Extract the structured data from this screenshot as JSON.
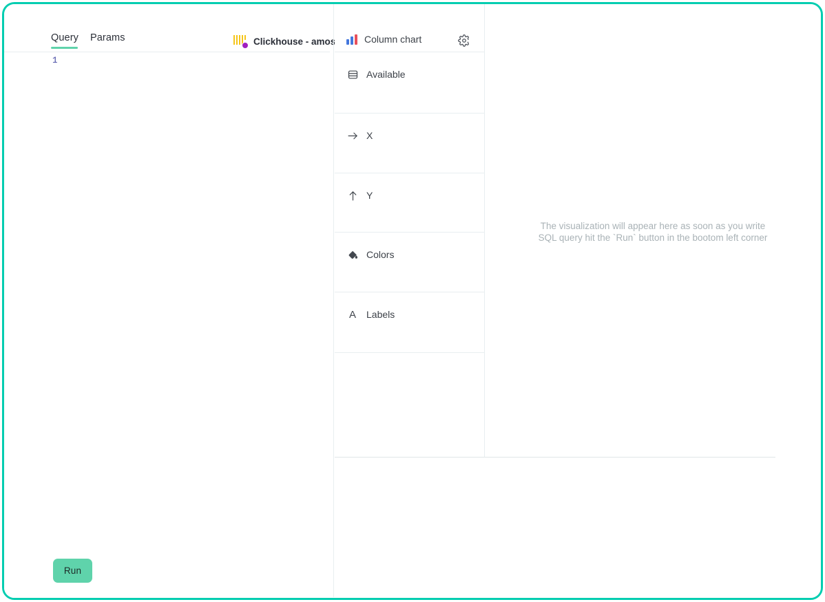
{
  "theme": {
    "frame_border_color": "#00cdb0",
    "accent_green": "#5fd3ab",
    "divider_color": "#e8eef0",
    "placeholder_text_color": "#a9b2b6"
  },
  "query_pane": {
    "tabs": [
      {
        "label": "Query",
        "active": true
      },
      {
        "label": "Params",
        "active": false
      }
    ],
    "connection": {
      "label": "Clickhouse - amos",
      "icon": "clickhouse-icon",
      "bar_color": "#f5c518",
      "badge_color": "#a020c0"
    },
    "editor": {
      "line_numbers": [
        "1"
      ],
      "code": "",
      "placeholder": ""
    },
    "run_button": {
      "label": "Run"
    }
  },
  "config_panel": {
    "header": {
      "chart_type": "Column chart",
      "chart_type_icon": "column-chart-icon",
      "settings_icon": "gear-icon"
    },
    "sections": [
      {
        "key": "available",
        "label": "Available",
        "icon": "database-icon",
        "items": []
      },
      {
        "key": "x",
        "label": "X",
        "icon": "arrow-right-icon",
        "items": []
      },
      {
        "key": "y",
        "label": "Y",
        "icon": "arrow-up-icon",
        "items": []
      },
      {
        "key": "colors",
        "label": "Colors",
        "icon": "paint-bucket-icon",
        "items": []
      },
      {
        "key": "labels",
        "label": "Labels",
        "icon": "letter-a-icon",
        "items": []
      }
    ]
  },
  "visualization": {
    "placeholder_text": "The visualization will appear here as soon as you write SQL query hit the `Run` button in the bootom left corner"
  }
}
